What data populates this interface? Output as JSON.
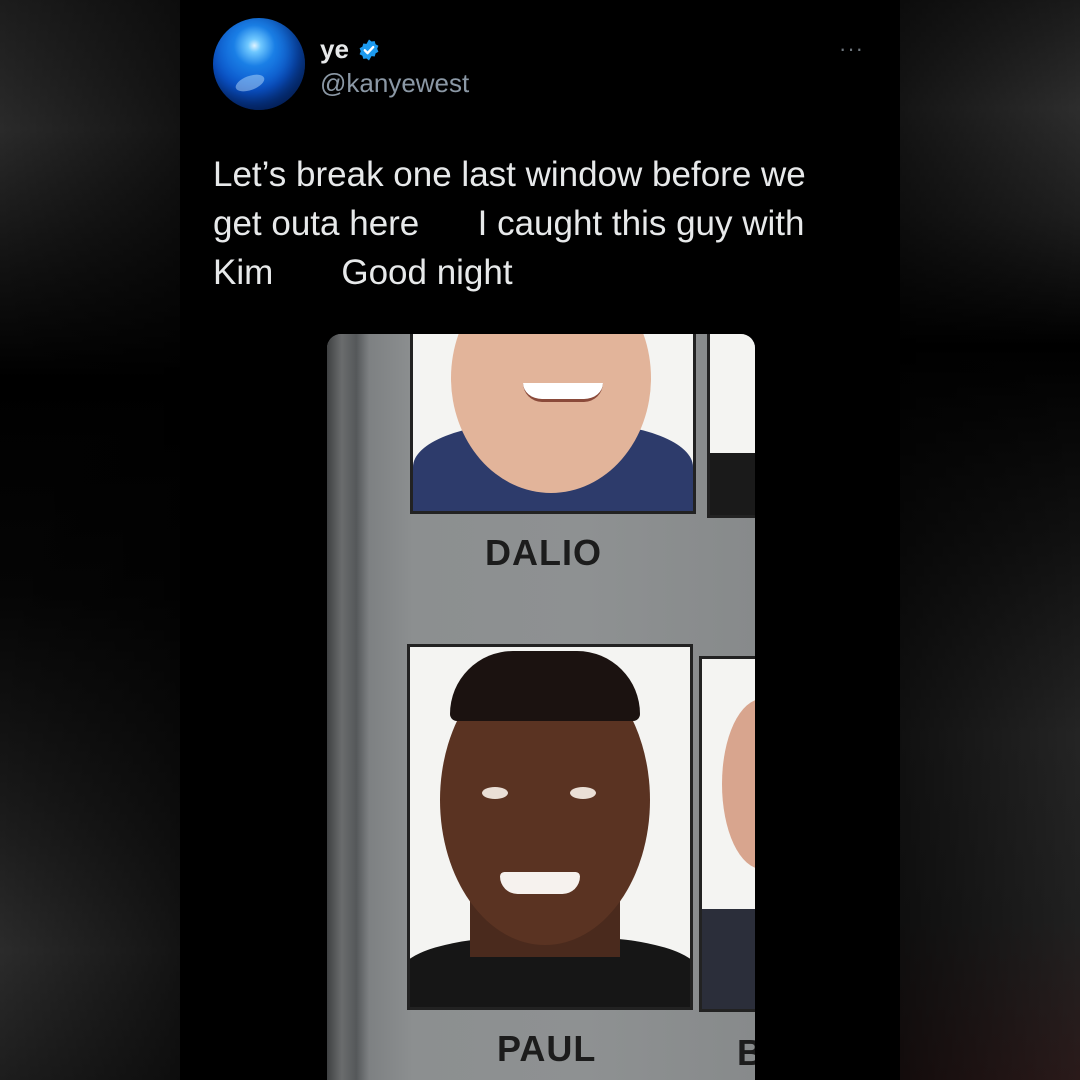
{
  "tweet": {
    "display_name": "ye",
    "handle": "@kanyewest",
    "more_menu": "···",
    "text": "Let’s break one last window before we\nget outa here      I caught this guy with\nKim       Good night"
  },
  "media": {
    "labels": [
      "DALIO",
      "PAUL",
      "B"
    ]
  },
  "icons": {
    "verified": "verified-badge-icon",
    "avatar": "blue-orb-avatar"
  },
  "colors": {
    "background": "#000000",
    "text": "#e7e9ea",
    "secondary_text": "#8b98a5",
    "verified_blue": "#1d9bf0"
  }
}
